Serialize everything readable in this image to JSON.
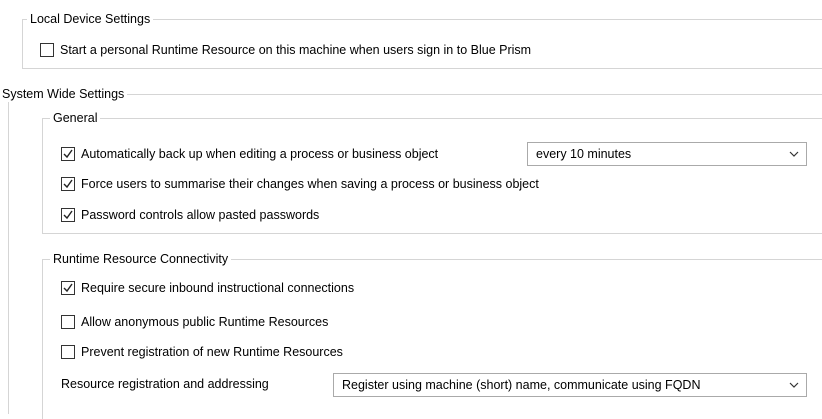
{
  "local_device": {
    "legend": "Local Device Settings",
    "start_runtime": {
      "label": "Start a personal Runtime Resource on this machine when users sign in to Blue Prism",
      "checked": false
    }
  },
  "system_wide": {
    "legend": "System Wide Settings",
    "general": {
      "legend": "General",
      "auto_backup": {
        "label": "Automatically back up when editing a process or business object",
        "checked": true
      },
      "backup_interval": {
        "value": "every 10 minutes"
      },
      "force_summarise": {
        "label": "Force users to summarise their changes when saving a process or business object",
        "checked": true
      },
      "password_paste": {
        "label": "Password controls allow pasted passwords",
        "checked": true
      }
    },
    "runtime_connectivity": {
      "legend": "Runtime Resource Connectivity",
      "secure_inbound": {
        "label": "Require secure inbound instructional connections",
        "checked": true
      },
      "anonymous_public": {
        "label": "Allow anonymous public Runtime Resources",
        "checked": false
      },
      "prevent_registration": {
        "label": "Prevent registration of new Runtime Resources",
        "checked": false
      },
      "registration_addressing": {
        "label": "Resource registration and addressing",
        "value": "Register using machine (short) name, communicate using FQDN"
      }
    }
  }
}
